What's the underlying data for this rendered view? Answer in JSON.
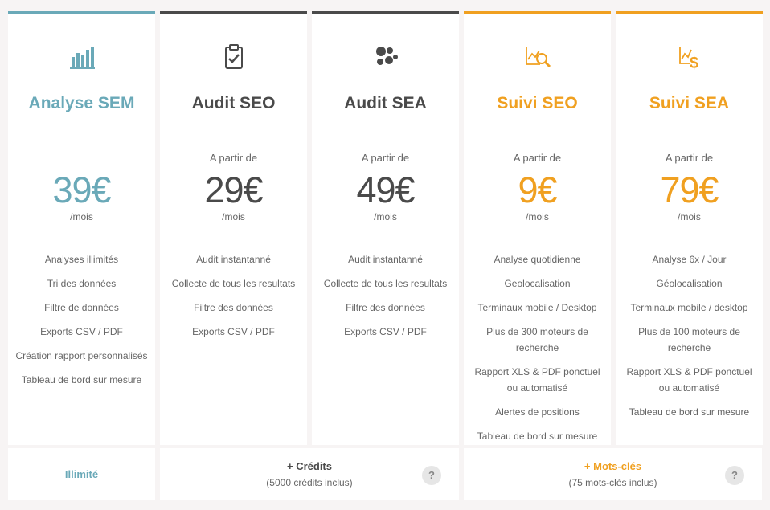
{
  "colors": {
    "teal": "#6aa9b8",
    "dark": "#4a4a4a",
    "orange": "#f0a020",
    "text": "#666666"
  },
  "plans": [
    {
      "title": "Analyse SEM",
      "from": "",
      "price": "39€",
      "period": "/mois",
      "color": "#6aa9b8",
      "icon": "bar-chart-icon",
      "features": [
        "Analyses illimités",
        "Tri des données",
        "Filtre de données",
        "Exports CSV / PDF",
        "Création rapport personnalisés",
        "Tableau de bord sur mesure"
      ]
    },
    {
      "title": "Audit SEO",
      "from": "A partir de",
      "price": "29€",
      "period": "/mois",
      "color": "#4a4a4a",
      "icon": "clipboard-check-icon",
      "features": [
        "Audit instantanné",
        "Collecte de tous les resultats",
        "Filtre des données",
        "Exports CSV / PDF"
      ]
    },
    {
      "title": "Audit SEA",
      "from": "A partir de",
      "price": "49€",
      "period": "/mois",
      "color": "#4a4a4a",
      "icon": "bubbles-icon",
      "features": [
        "Audit instantanné",
        "Collecte de tous les resultats",
        "Filtre des données",
        "Exports CSV / PDF"
      ]
    },
    {
      "title": "Suivi SEO",
      "from": "A partir de",
      "price": "9€",
      "period": "/mois",
      "color": "#f0a020",
      "icon": "chart-magnifier-icon",
      "features": [
        "Analyse quotidienne",
        "Geolocalisation",
        "Terminaux mobile / Desktop",
        "Plus de 300 moteurs de recherche",
        "Rapport XLS & PDF ponctuel ou automatisé",
        "Alertes de positions",
        "Tableau de bord sur mesure"
      ]
    },
    {
      "title": "Suivi SEA",
      "from": "A partir de",
      "price": "79€",
      "period": "/mois",
      "color": "#f0a020",
      "icon": "chart-dollar-icon",
      "features": [
        "Analyse 6x / Jour",
        "Géolocalisation",
        "Terminaux mobile / desktop",
        "Plus de 100 moteurs de recherche",
        "Rapport XLS & PDF ponctuel ou automatisé",
        "Tableau de bord sur mesure"
      ]
    }
  ],
  "footers": {
    "unlimited": "Illimité",
    "credits_title": "+ Crédits",
    "credits_sub": "(5000 crédits inclus)",
    "keywords_title": "+ Mots-clés",
    "keywords_sub": "(75 mots-clés inclus)",
    "help": "?"
  }
}
